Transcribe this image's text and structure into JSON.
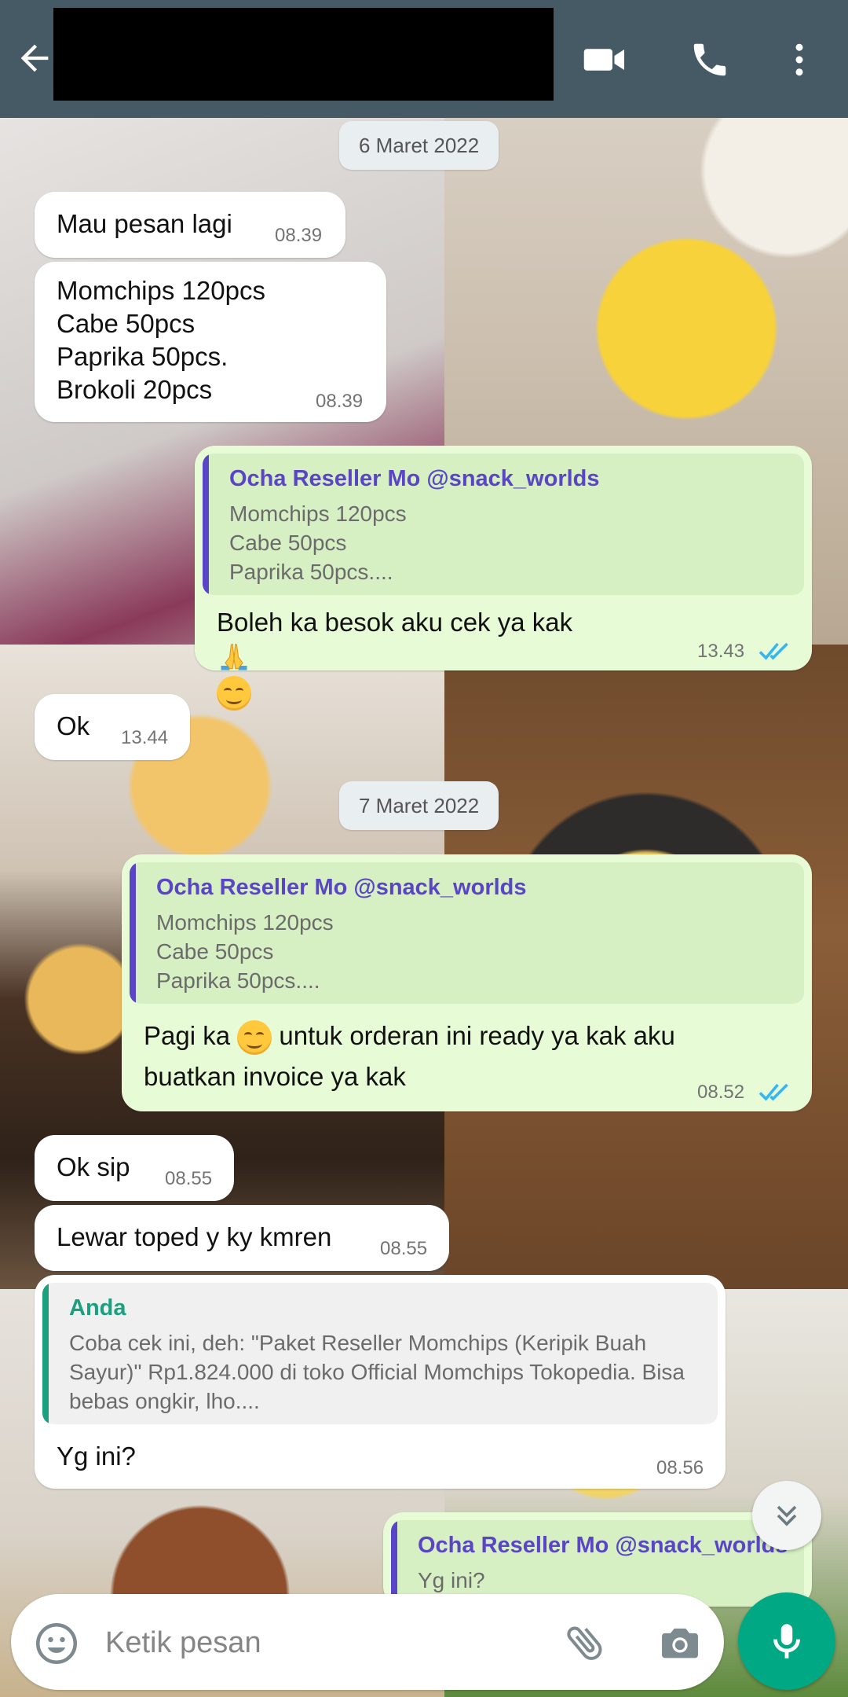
{
  "header": {
    "contact_name": ""
  },
  "date_chips": [
    "6 Maret 2022",
    "7 Maret 2022"
  ],
  "messages": [
    {
      "dir": "in",
      "text": "Mau pesan lagi",
      "time": "08.39"
    },
    {
      "dir": "in",
      "text": "Momchips 120pcs\nCabe 50pcs\nPaprika 50pcs.\nBrokoli 20pcs",
      "time": "08.39"
    },
    {
      "dir": "out",
      "quote": {
        "name": "Ocha Reseller Mo @snack_worlds",
        "text": "Momchips 120pcs\nCabe 50pcs\nPaprika 50pcs...."
      },
      "text": "Boleh ka besok aku cek ya kak",
      "time": "13.43"
    },
    {
      "dir": "in",
      "text": "Ok",
      "time": "13.44"
    },
    {
      "dir": "out",
      "quote": {
        "name": "Ocha Reseller Mo @snack_worlds",
        "text": "Momchips 120pcs\nCabe 50pcs\nPaprika 50pcs...."
      },
      "text_before_emoji": "Pagi ka",
      "text_after_emoji": " untuk orderan ini ready ya kak aku",
      "text_line2": "buatkan invoice ya kak",
      "time": "08.52"
    },
    {
      "dir": "in",
      "text": "Ok sip",
      "time": "08.55"
    },
    {
      "dir": "in",
      "text": "Lewar toped y ky kmren",
      "time": "08.55"
    },
    {
      "dir": "in",
      "quote": {
        "name": "Anda",
        "text": "Coba cek ini, deh: \"Paket Reseller Momchips (Keripik Buah Sayur)\" Rp1.824.000 di toko Official Momchips Tokopedia. Bisa bebas ongkir, lho...."
      },
      "text": "Yg ini?",
      "time": "08.56"
    },
    {
      "dir": "out",
      "quote": {
        "name": "Ocha Reseller Mo @snack_worlds",
        "text": "Yg ini?"
      }
    }
  ],
  "composer": {
    "placeholder": "Ketik pesan"
  },
  "icons": [
    "back-arrow-icon",
    "video-call-icon",
    "phone-icon",
    "more-vert-icon",
    "double-check-icon",
    "scroll-down-icon",
    "emoji-icon",
    "attach-icon",
    "camera-icon",
    "mic-icon"
  ],
  "colors": {
    "header": "#455a64",
    "outgoing_bubble": "#e7fcd6",
    "incoming_bubble": "#ffffff",
    "read_ticks": "#34b7f1",
    "quote_name_out": "#5a45c6",
    "quote_name_anda": "#1aa07f",
    "mic_button": "#00a884"
  }
}
